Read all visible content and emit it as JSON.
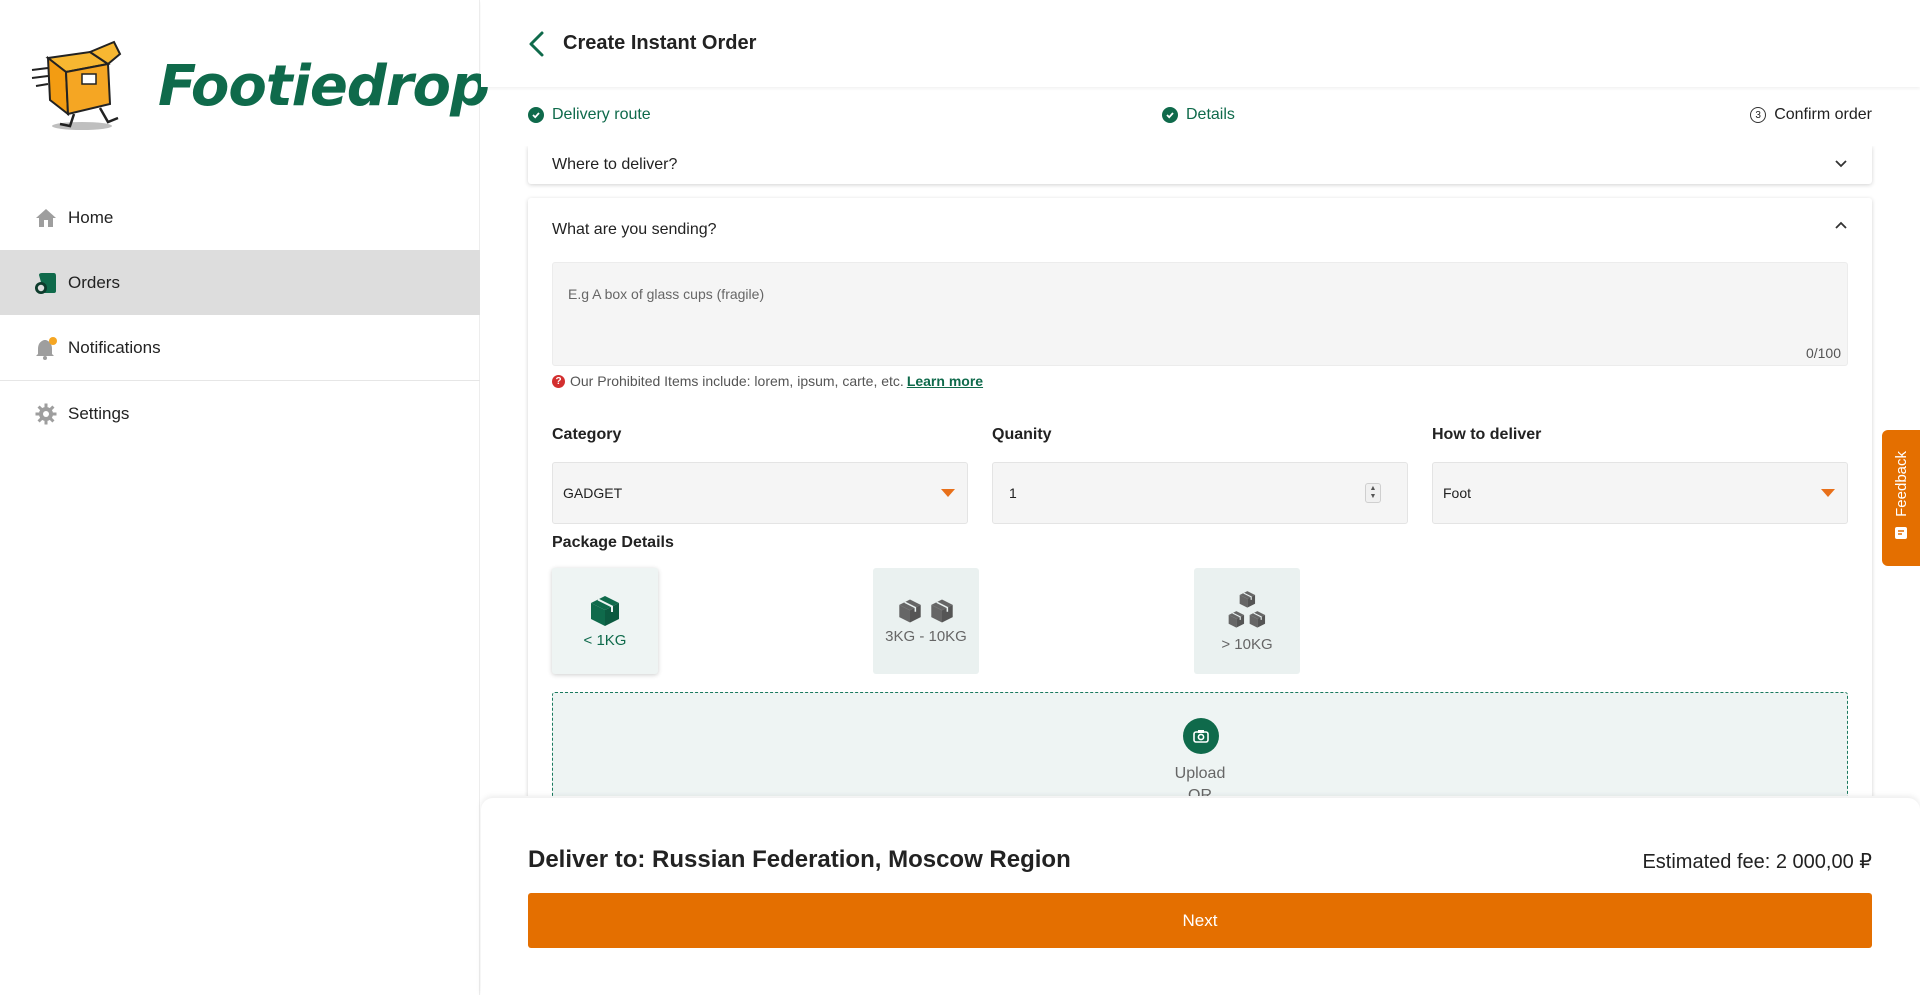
{
  "app": {
    "brand": "Footiedrop",
    "brand_color": "#0f6a4b",
    "accent_color": "#e46f00"
  },
  "sidebar": {
    "items": [
      {
        "label": "Home",
        "icon": "home-icon",
        "active": false
      },
      {
        "label": "Orders",
        "icon": "orders-icon",
        "active": true
      },
      {
        "label": "Notifications",
        "icon": "bell-icon",
        "active": false
      },
      {
        "label": "Settings",
        "icon": "gear-icon",
        "active": false
      }
    ]
  },
  "header": {
    "title": "Create Instant Order"
  },
  "stepper": {
    "steps": [
      {
        "label": "Delivery route",
        "status": "done"
      },
      {
        "label": "Details",
        "status": "done"
      },
      {
        "label": "Confirm order",
        "status": "pending",
        "number": "3"
      }
    ]
  },
  "sections": {
    "where": {
      "title": "Where to deliver?"
    },
    "what": {
      "title": "What are you sending?",
      "description_placeholder": "E.g A box of glass cups (fragile)",
      "char_count": "0/100",
      "prohibited_text": "Our Prohibited Items include: lorem, ipsum, carte, etc.",
      "learn_more": "Learn more",
      "category": {
        "label": "Category",
        "value": "GADGET"
      },
      "quantity": {
        "label": "Quanity",
        "value": "1"
      },
      "how": {
        "label": "How to deliver",
        "value": "Foot"
      },
      "package": {
        "label": "Package Details",
        "options": [
          {
            "label": "< 1KG",
            "selected": true
          },
          {
            "label": "3KG - 10KG",
            "selected": false
          },
          {
            "label": "> 10KG",
            "selected": false
          }
        ]
      },
      "upload": {
        "label": "Upload",
        "or": "OR"
      }
    }
  },
  "footer": {
    "deliver_to": "Deliver to: Russian Federation, Moscow Region",
    "fee": "Estimated fee: 2 000,00 ₽",
    "next_label": "Next"
  },
  "feedback": {
    "label": "Feedback"
  }
}
